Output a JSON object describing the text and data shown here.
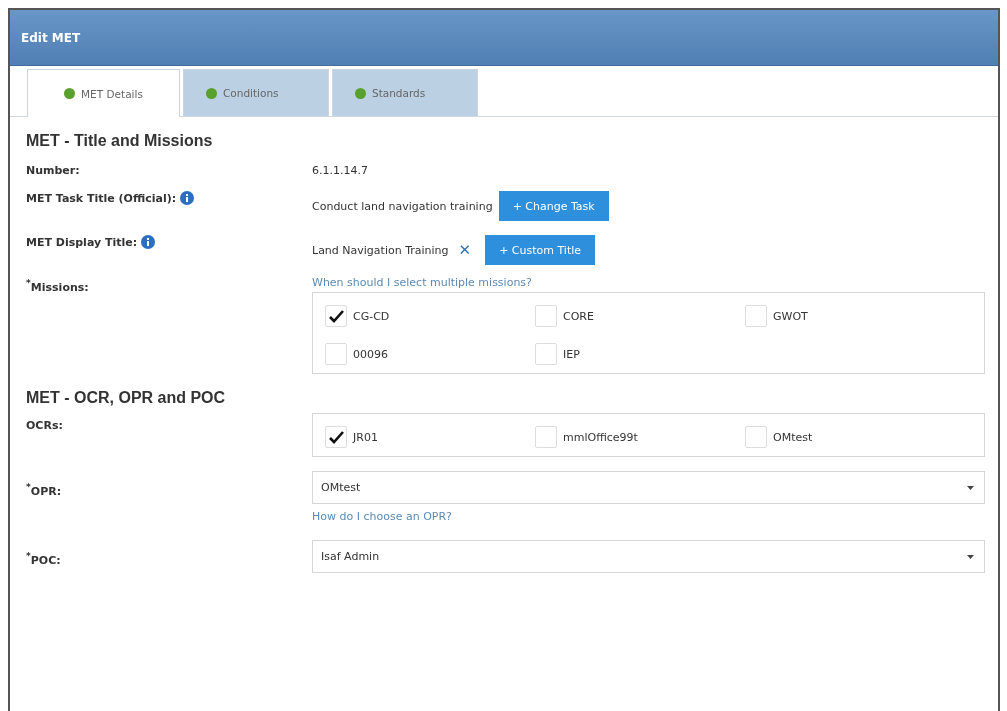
{
  "window": {
    "title": "Edit MET"
  },
  "tabs": [
    {
      "label": "MET Details",
      "selected": true,
      "color": "#5aa02c"
    },
    {
      "label": "Conditions",
      "selected": false,
      "color": "#5aa02c"
    },
    {
      "label": "Standards",
      "selected": false,
      "color": "#5aa02c"
    }
  ],
  "sections": [
    {
      "heading": "MET - Title and Missions",
      "fields": [
        {
          "kind": "text",
          "label": "Number:",
          "value": "6.1.1.14.7"
        },
        {
          "kind": "text-button",
          "label": "MET Task Title (Official):",
          "info": true,
          "value": "Conduct land navigation training",
          "button": "+ Change Task"
        },
        {
          "kind": "text-button",
          "label": "MET Display Title:",
          "info": true,
          "value": "Land Navigation Training",
          "clear": "✕",
          "button": "+ Custom Title"
        },
        {
          "kind": "checks",
          "label": "$^{*}$Missions:",
          "link": "When should I select multiple missions?",
          "options": [
            {
              "label": "CG-CD",
              "checked": true
            },
            {
              "label": "CORE",
              "checked": false
            },
            {
              "label": "GWOT",
              "checked": false
            },
            {
              "label": "00096",
              "checked": false
            },
            {
              "label": "IEP",
              "checked": false
            }
          ]
        }
      ]
    },
    {
      "heading": "MET - OCR, OPR and POC",
      "fields": [
        {
          "kind": "checks",
          "label": "OCRs:",
          "options": [
            {
              "label": "JR01",
              "checked": true
            },
            {
              "label": "mmlOffice99t",
              "checked": false
            },
            {
              "label": "OMtest",
              "checked": false
            }
          ]
        },
        {
          "kind": "select",
          "label": "$^{*}$OPR:",
          "value": "OMtest",
          "link": "How do I choose an OPR?"
        },
        {
          "kind": "select",
          "label": "$^{*}$POC:",
          "value": "Isaf Admin"
        }
      ]
    }
  ]
}
